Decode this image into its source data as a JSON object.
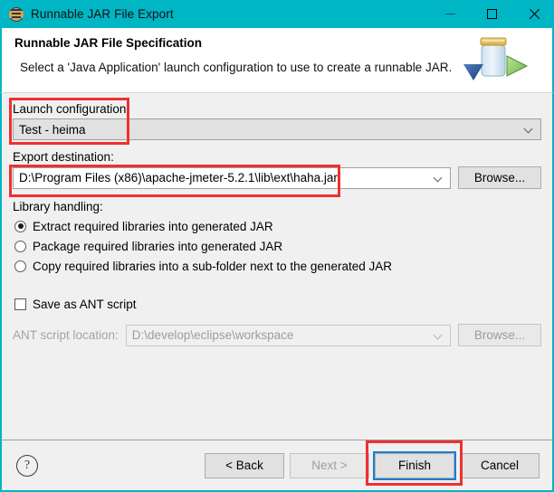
{
  "window": {
    "title": "Runnable JAR File Export",
    "icon": "eclipse-export-icon",
    "titlebar_color": "#00b5c4",
    "controls": {
      "minimize": "minimize-icon",
      "maximize": "maximize-icon",
      "close": "close-icon"
    }
  },
  "header": {
    "title": "Runnable JAR File Specification",
    "subtitle": "Select a 'Java Application' launch configuration to use to create a runnable JAR.",
    "banner_icon": "jar-export-icon"
  },
  "form": {
    "launch_configuration": {
      "label": "Launch configuration:",
      "value": "Test - heima",
      "dropdown_icon": "chevron-down-icon",
      "highlighted": true
    },
    "export_destination": {
      "label": "Export destination:",
      "value": "D:\\Program Files (x86)\\apache-jmeter-5.2.1\\lib\\ext\\haha.jar",
      "dropdown_icon": "chevron-down-icon",
      "browse_label": "Browse...",
      "highlighted": true
    },
    "library_handling": {
      "label": "Library handling:",
      "options": [
        {
          "label": "Extract required libraries into generated JAR",
          "selected": true
        },
        {
          "label": "Package required libraries into generated JAR",
          "selected": false
        },
        {
          "label": "Copy required libraries into a sub-folder next to the generated JAR",
          "selected": false
        }
      ]
    },
    "ant_script": {
      "checkbox_label": "Save as ANT script",
      "checked": false,
      "location_label": "ANT script location:",
      "location_value": "D:\\develop\\eclipse\\workspace",
      "dropdown_icon": "chevron-down-icon",
      "browse_label": "Browse...",
      "enabled": false
    }
  },
  "footer": {
    "help_icon": "question-mark-icon",
    "buttons": [
      {
        "label": "< Back",
        "enabled": true,
        "focused": false,
        "highlighted": false
      },
      {
        "label": "Next >",
        "enabled": false,
        "focused": false,
        "highlighted": false
      },
      {
        "label": "Finish",
        "enabled": true,
        "focused": true,
        "highlighted": true
      },
      {
        "label": "Cancel",
        "enabled": true,
        "focused": false,
        "highlighted": false
      }
    ]
  },
  "annotations": {
    "color": "#f03030",
    "boxes": [
      {
        "name": "launch-configuration-highlight"
      },
      {
        "name": "export-destination-highlight"
      },
      {
        "name": "finish-button-highlight"
      }
    ]
  }
}
